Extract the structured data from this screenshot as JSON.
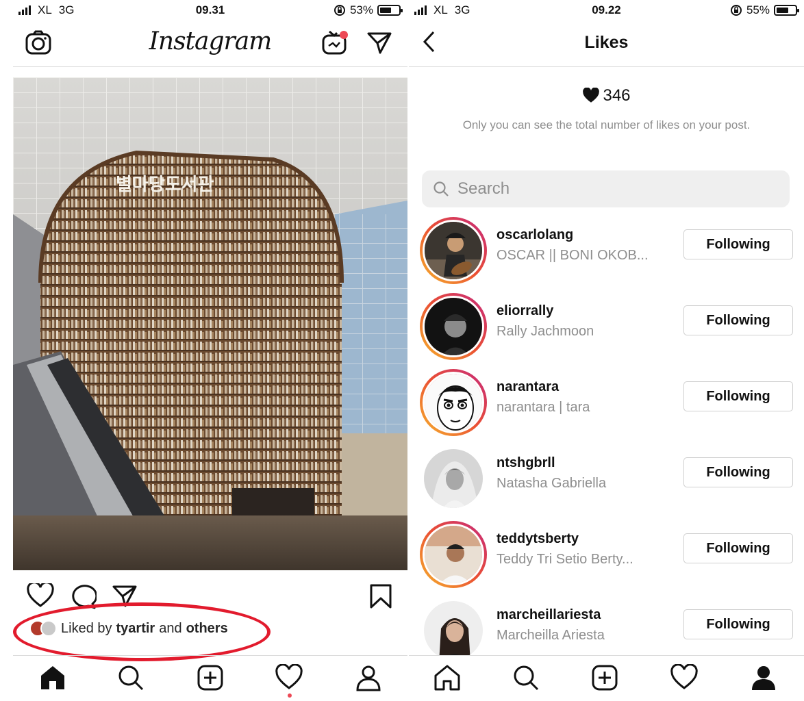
{
  "left_screen": {
    "status": {
      "carrier": "XL",
      "network": "3G",
      "time": "09.31",
      "battery_percent": "53%",
      "battery_level": 0.53
    },
    "header": {
      "logo": "Instagram"
    },
    "post": {
      "image_title": "별마당도서관"
    },
    "likes": {
      "prefix": "Liked by",
      "user": "tyartir",
      "connector": "and",
      "others": "others"
    },
    "tabbar": [
      "home-icon",
      "search-icon",
      "add-icon",
      "heart-icon",
      "profile-icon"
    ],
    "colors": {
      "annotation": "#e21b2d",
      "notification_dot": "#ed4956"
    }
  },
  "right_screen": {
    "status": {
      "carrier": "XL",
      "network": "3G",
      "time": "09.22",
      "battery_percent": "55%",
      "battery_level": 0.55
    },
    "header": {
      "title": "Likes"
    },
    "like_count": "346",
    "note": "Only you can see the total number of likes on your post.",
    "search": {
      "placeholder": "Search"
    },
    "users": [
      {
        "username": "oscarlolang",
        "fullname": "OSCAR || BONI OKOB...",
        "button": "Following"
      },
      {
        "username": "eliorrally",
        "fullname": "Rally Jachmoon",
        "button": "Following"
      },
      {
        "username": "narantara",
        "fullname": "narantara | tara",
        "button": "Following"
      },
      {
        "username": "ntshgbrll",
        "fullname": "Natasha Gabriella",
        "button": "Following"
      },
      {
        "username": "teddytsberty",
        "fullname": "Teddy Tri Setio Berty...",
        "button": "Following"
      },
      {
        "username": "marcheillariesta",
        "fullname": "Marcheilla Ariesta",
        "button": "Following"
      }
    ],
    "tabbar": [
      "home-icon",
      "search-icon",
      "add-icon",
      "heart-icon",
      "profile-icon"
    ]
  }
}
